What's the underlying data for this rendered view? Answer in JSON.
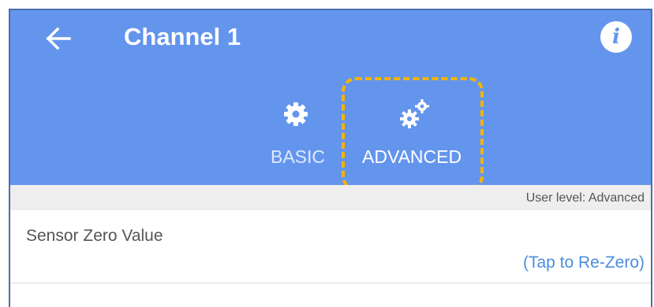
{
  "header": {
    "title": "Channel 1",
    "back_icon": "arrow-left-icon",
    "info_icon": "info-icon",
    "info_glyph": "i",
    "background_color": "#6495ed"
  },
  "tabs": [
    {
      "label": "BASIC",
      "icon": "gear-icon",
      "selected": false
    },
    {
      "label": "ADVANCED",
      "icon": "gears-icon",
      "selected": true
    }
  ],
  "status": {
    "user_level": "User level: Advanced"
  },
  "settings": [
    {
      "label": "Sensor Zero Value",
      "action": "(Tap to Re-Zero)"
    }
  ],
  "colors": {
    "highlight": "#f5b400",
    "link": "#4a8de0"
  }
}
